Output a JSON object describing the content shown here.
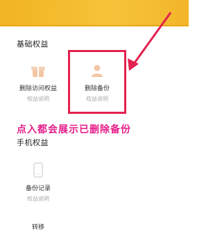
{
  "banner": {
    "color": "#f4bb2e"
  },
  "basic_section": {
    "title": "基础权益",
    "items": [
      {
        "label": "删除访问权益",
        "sub": "权益说明",
        "icon": "gift-icon"
      },
      {
        "label": "删除备份",
        "sub": "权益说明",
        "icon": "user-icon"
      }
    ]
  },
  "annotation": {
    "text": "点入都会展示已删除备份"
  },
  "extra_section": {
    "title": "手机权益",
    "items": [
      {
        "label": "备份记录",
        "sub": "权益说明",
        "icon": "phone-icon"
      },
      {
        "label": "转移",
        "sub": "",
        "icon": "phone-icon"
      }
    ]
  },
  "colors": {
    "highlight": "#e3204f",
    "annotation": "#e61e8a",
    "icon": "#f3c7a6"
  }
}
